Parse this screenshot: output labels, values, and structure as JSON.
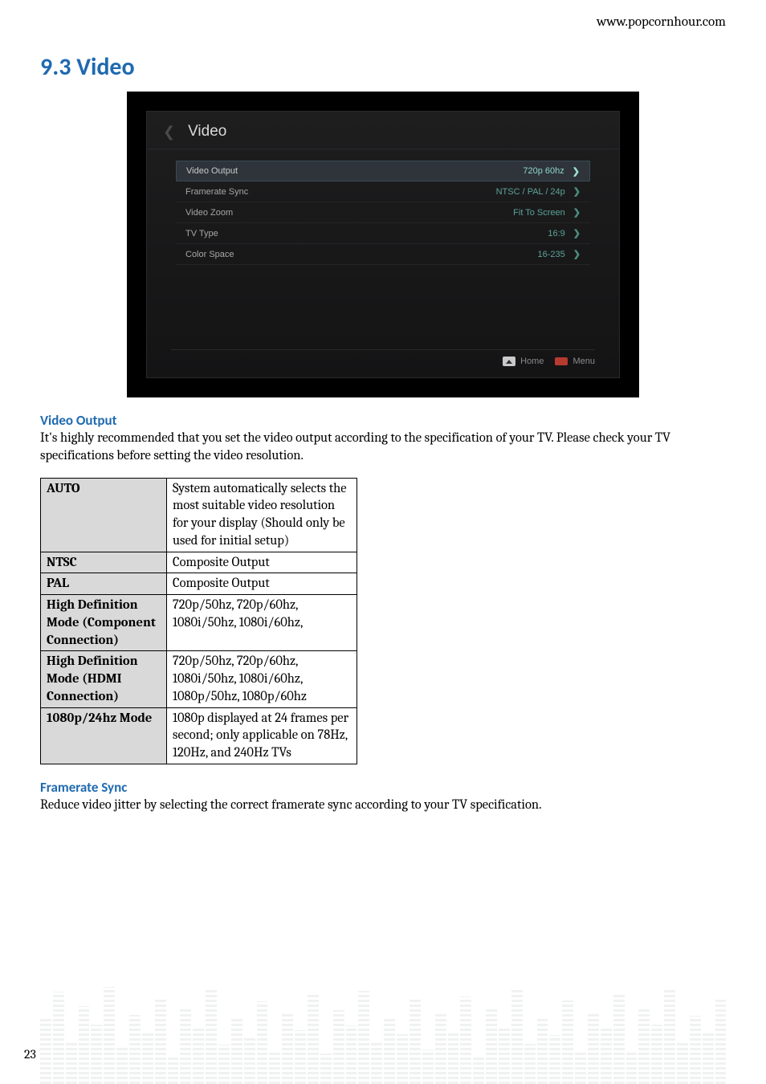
{
  "header": {
    "url": "www.popcornhour.com"
  },
  "section": {
    "title": "9.3 Video"
  },
  "screen": {
    "title": "Video",
    "footer": {
      "home": "Home",
      "menu": "Menu"
    },
    "rows": [
      {
        "label": "Video Output",
        "value": "720p 60hz",
        "selected": true
      },
      {
        "label": "Framerate Sync",
        "value": "NTSC / PAL / 24p",
        "selected": false
      },
      {
        "label": "Video Zoom",
        "value": "Fit To Screen",
        "selected": false
      },
      {
        "label": "TV Type",
        "value": "16:9",
        "selected": false
      },
      {
        "label": "Color Space",
        "value": "16-235",
        "selected": false
      }
    ]
  },
  "video_output": {
    "heading": "Video Output",
    "para": "It's highly recommended that you set the video output according to the specification of your TV. Please check your TV specifications before setting the video resolution.",
    "table": [
      {
        "k": "AUTO",
        "v": "System automatically selects the most suitable video resolution for your display (Should only be used for initial setup)"
      },
      {
        "k": "NTSC",
        "v": "Composite Output"
      },
      {
        "k": "PAL",
        "v": "Composite Output"
      },
      {
        "k": "High Definition Mode (Component Connection)",
        "v": "720p/50hz, 720p/60hz, 1080i/50hz, 1080i/60hz,"
      },
      {
        "k": "High Definition Mode\n(HDMI Connection)",
        "v": "720p/50hz, 720p/60hz, 1080i/50hz, 1080i/60hz, 1080p/50hz, 1080p/60hz"
      },
      {
        "k": "1080p/24hz Mode",
        "v": "1080p displayed at 24 frames per second; only applicable on 78Hz, 120Hz, and 240Hz TVs"
      }
    ]
  },
  "framerate": {
    "heading": "Framerate Sync",
    "para": "Reduce video jitter by selecting the correct framerate sync according to your TV specification."
  },
  "page_number": "23"
}
